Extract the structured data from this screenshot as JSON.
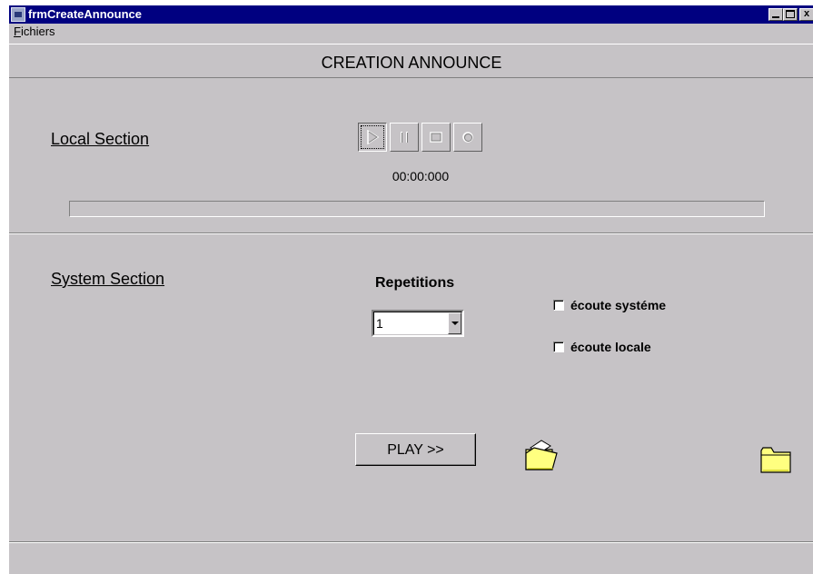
{
  "window": {
    "title": "frmCreateAnnounce",
    "controls": {
      "minimize": "_",
      "maximize": "",
      "close": "x"
    }
  },
  "menu": {
    "items": [
      {
        "label": "Fichiers"
      }
    ]
  },
  "header": {
    "title": "CREATION ANNOUNCE"
  },
  "local_section": {
    "label": "Local Section",
    "media_buttons": [
      "play-icon",
      "pause-icon",
      "stop-icon",
      "record-icon"
    ],
    "timer": "00:00:000",
    "progress": 0
  },
  "system_section": {
    "label": "System Section",
    "repetitions_label": "Repetitions",
    "repetitions_value": "1",
    "checkbox_system": {
      "label": "écoute systéme",
      "checked": false
    },
    "checkbox_local": {
      "label": "écoute locale",
      "checked": false
    },
    "play_button": "PLAY >>",
    "icons": [
      "open-folder-icon",
      "closed-folder-icon"
    ]
  },
  "colors": {
    "titlebar": "#000080",
    "face": "#c6c3c6",
    "folder": "#ffff80"
  }
}
